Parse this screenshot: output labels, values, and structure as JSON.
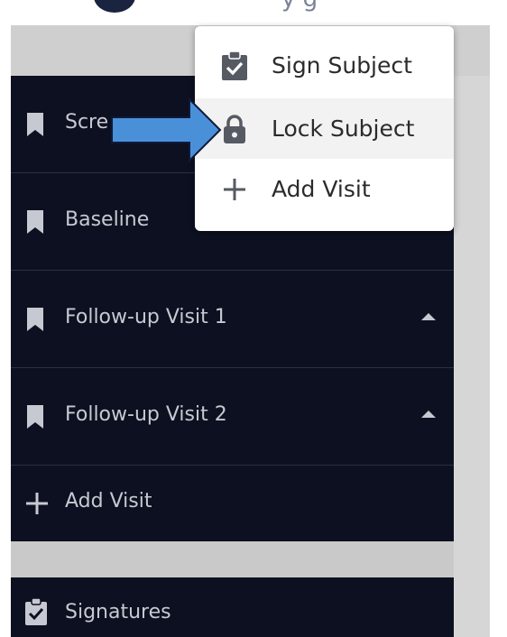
{
  "header": {
    "title_fragment": "y  g"
  },
  "visits": [
    {
      "label": "Scre",
      "icon": "bookmark-icon",
      "expandable": false
    },
    {
      "label": "Baseline",
      "icon": "bookmark-icon",
      "expandable": false
    },
    {
      "label": "Follow-up Visit 1",
      "icon": "bookmark-icon",
      "expandable": true
    },
    {
      "label": "Follow-up Visit 2",
      "icon": "bookmark-icon",
      "expandable": true
    }
  ],
  "add_visit": {
    "label": "Add Visit",
    "icon": "plus-icon"
  },
  "signatures": {
    "label": "Signatures",
    "icon": "clipboard-check-icon"
  },
  "menu": {
    "items": [
      {
        "label": "Sign Subject",
        "icon": "clipboard-check-icon"
      },
      {
        "label": "Lock Subject",
        "icon": "lock-icon"
      },
      {
        "label": "Add Visit",
        "icon": "plus-icon"
      }
    ]
  },
  "colors": {
    "panel": "#0d1020",
    "panel_text": "#c7c9d2",
    "backdrop": "#d6d6d6",
    "menu_bg": "#ffffff",
    "menu_active": "#f2f2f2",
    "arrow": "#4a90d9"
  }
}
